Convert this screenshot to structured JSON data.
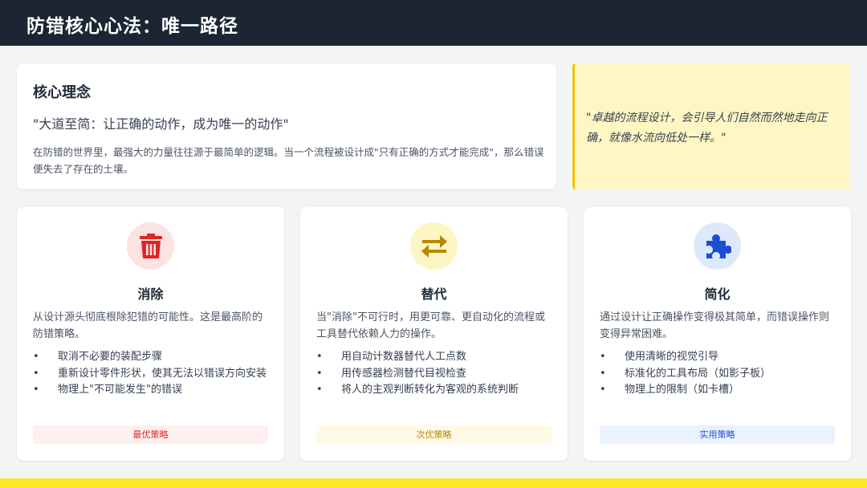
{
  "header": {
    "title": "防错核心心法：唯一路径"
  },
  "concept": {
    "title": "核心理念",
    "quote": "\"大道至简：让正确的动作，成为唯一的动作\"",
    "description": "在防错的世界里，最强大的力量往往源于最简单的逻辑。当一个流程被设计成\"只有正确的方式才能完成\"，那么错误便失去了存在的土壤。"
  },
  "callout": {
    "quote": "\"卓越的流程设计，会引导人们自然而然地走向正确，就像水流向低处一样。\""
  },
  "cards": [
    {
      "icon": "trash-icon",
      "title": "消除",
      "description": "从设计源头彻底根除犯错的可能性。这是最高阶的防错策略。",
      "items": [
        "取消不必要的装配步骤",
        "重新设计零件形状，使其无法以错误方向安装",
        "物理上\"不可能发生\"的错误"
      ],
      "tag": "最优策略",
      "accent": "#dc2626",
      "icon_bg": "#fde2e2",
      "tag_bg": "#fef0f0"
    },
    {
      "icon": "swap-arrows-icon",
      "title": "替代",
      "description": "当\"消除\"不可行时，用更可靠、更自动化的流程或工具替代依赖人力的操作。",
      "items": [
        "用自动计数器替代人工点数",
        "用传感器检测替代目视检查",
        "将人的主观判断转化为客观的系统判断"
      ],
      "tag": "次优策略",
      "accent": "#b88600",
      "icon_bg": "#fdf5c3",
      "tag_bg": "#fefae6"
    },
    {
      "icon": "puzzle-icon",
      "title": "简化",
      "description": "通过设计让正确操作变得极其简单，而错误操作则变得异常困难。",
      "items": [
        "使用清晰的视觉引导",
        "标准化的工具布局（如影子板）",
        "物理上的限制（如卡槽）"
      ],
      "tag": "实用策略",
      "accent": "#1d4ed8",
      "icon_bg": "#dde9fb",
      "tag_bg": "#eaf2fe"
    }
  ]
}
